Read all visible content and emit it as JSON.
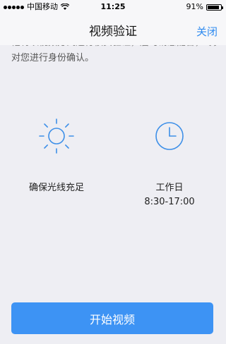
{
  "status_bar": {
    "carrier": "中国移动",
    "time": "11:25",
    "battery": "91%",
    "battery_level": 0.91,
    "signal_icon": "signal-dots-icon",
    "wifi_icon": "wifi-icon",
    "battery_icon": "battery-icon"
  },
  "nav": {
    "title": "视频验证",
    "close_label": "关闭"
  },
  "intro": {
    "line_cut": "他将以视频方式进行核实验证，届时请您配合，专员将",
    "line2": "对您进行身份确认。"
  },
  "tips": [
    {
      "icon": "sun-icon",
      "text": "确保光线充足"
    },
    {
      "icon": "clock-icon",
      "title": "工作日",
      "hours": "8:30-17:00"
    }
  ],
  "actions": {
    "start_label": "开始视频"
  },
  "colors": {
    "accent": "#3d93f4",
    "icon_blue": "#3d8fe8",
    "background": "#eeeef3",
    "bar_background": "#f7f7f9"
  }
}
